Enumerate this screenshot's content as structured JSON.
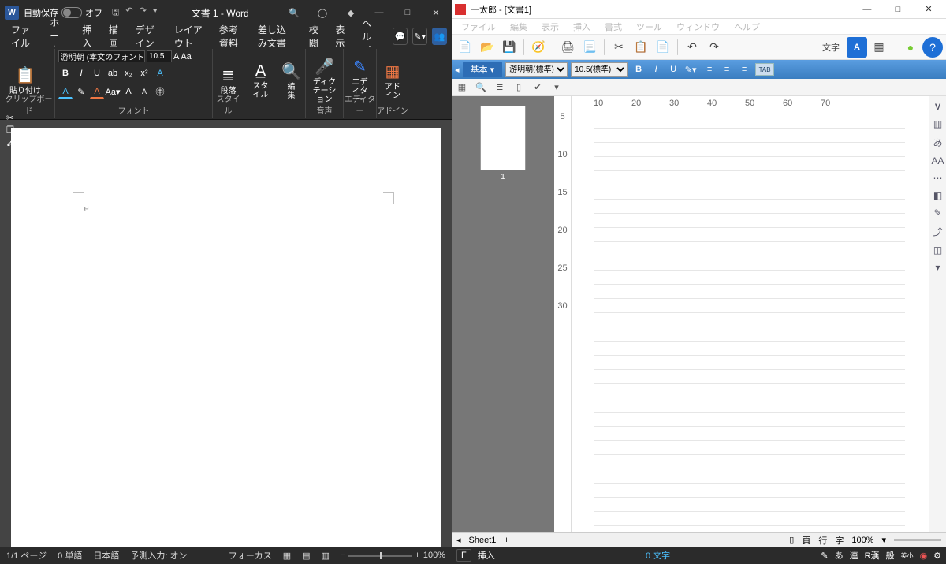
{
  "word": {
    "autosave_label": "自動保存",
    "autosave_state": "オフ",
    "doc_title": "文書 1 - Word",
    "tabs": [
      "ファイル",
      "ホーム",
      "挿入",
      "描画",
      "デザイン",
      "レイアウト",
      "参考資料",
      "差し込み文書",
      "校閲",
      "表示",
      "ヘルプ"
    ],
    "active_tab": 1,
    "ribbon": {
      "clipboard_label": "クリップボード",
      "paste": "貼り付け",
      "font_label": "フォント",
      "font_name": "游明朝 (本文のフォント - 日本語",
      "font_size": "10.5",
      "style_label": "スタイル",
      "paragraph": "段落",
      "styles": "スタイル",
      "editing": "編集",
      "dictation": "ディクテーション",
      "editor": "エディター",
      "addin": "アドイン"
    },
    "status": {
      "page": "1/1 ページ",
      "words": "0 単語",
      "lang": "日本語",
      "predict": "予測入力: オン",
      "focus": "フォーカス",
      "zoom": "100%"
    }
  },
  "ichi": {
    "title": "一太郎 - [文書1]",
    "menus": [
      "ファイル",
      "編集",
      "表示",
      "挿入",
      "書式",
      "ツール",
      "ウィンドウ",
      "ヘルプ"
    ],
    "toolbar": {
      "moji": "文字"
    },
    "tab_basic": "基本",
    "font_name": "游明朝(標準)",
    "font_size": "10.5(標準)",
    "tab_label": "TAB",
    "hruler": [
      "10",
      "20",
      "30",
      "40",
      "50",
      "60",
      "70"
    ],
    "vruler": [
      "5",
      "10",
      "15",
      "20",
      "25",
      "30"
    ],
    "sheet": "Sheet1",
    "status": {
      "sheet_btns": [
        "頁",
        "行",
        "字"
      ],
      "zoom": "100%"
    },
    "task": {
      "mode": "挿入",
      "chars": "0 文字",
      "ime": [
        "あ",
        "連",
        "R漢",
        "般",
        "英小"
      ],
      "f_label": "F"
    },
    "thumb_page": "1"
  }
}
